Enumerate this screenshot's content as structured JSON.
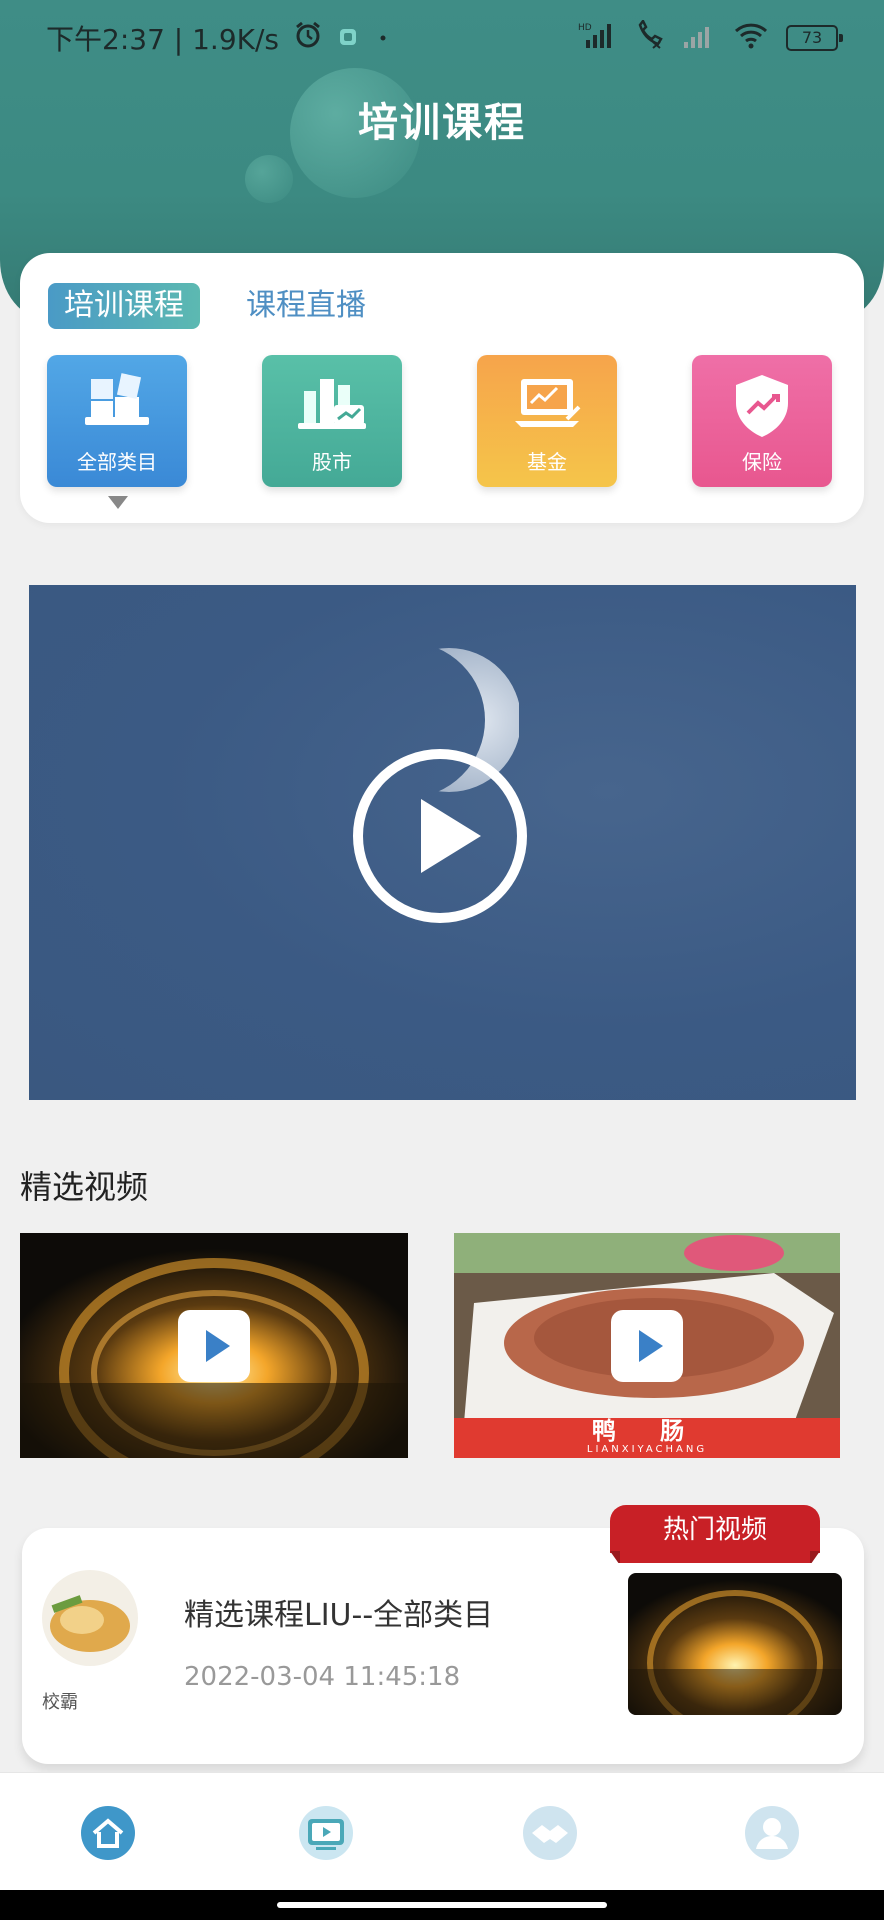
{
  "status_bar": {
    "time_speed": "下午2:37 | 1.9K/s",
    "battery": "73",
    "icons": [
      "alarm-icon",
      "app-notification-icon",
      "hd-signal-icon",
      "call-muted-icon",
      "signal-icon",
      "wifi-icon",
      "battery-icon"
    ]
  },
  "header": {
    "title": "培训课程"
  },
  "tabs": [
    {
      "label": "培训课程",
      "active": true
    },
    {
      "label": "课程直播",
      "active": false
    }
  ],
  "categories": [
    {
      "label": "全部类目",
      "icon": "all-categories-icon",
      "color": "#4a9be0"
    },
    {
      "label": "股市",
      "icon": "stock-market-icon",
      "color": "#4fb59f"
    },
    {
      "label": "基金",
      "icon": "fund-icon",
      "color": "#f5b24a"
    },
    {
      "label": "保险",
      "icon": "insurance-icon",
      "color": "#ec6a9d"
    }
  ],
  "featured": {
    "title": "精选视频"
  },
  "featured_thumbs": [
    {
      "icon": "play-icon"
    },
    {
      "icon": "play-icon",
      "banner_text": "鸭 肠",
      "banner_sub": "LIANXIYACHANG"
    }
  ],
  "hot": {
    "tag": "热门视频",
    "title": "精选课程LIU--全部类目",
    "date": "2022-03-04 11:45:18",
    "author": "校霸"
  },
  "bottom_nav": [
    {
      "icon": "home-icon"
    },
    {
      "icon": "video-icon"
    },
    {
      "icon": "handshake-icon"
    },
    {
      "icon": "profile-icon"
    }
  ]
}
